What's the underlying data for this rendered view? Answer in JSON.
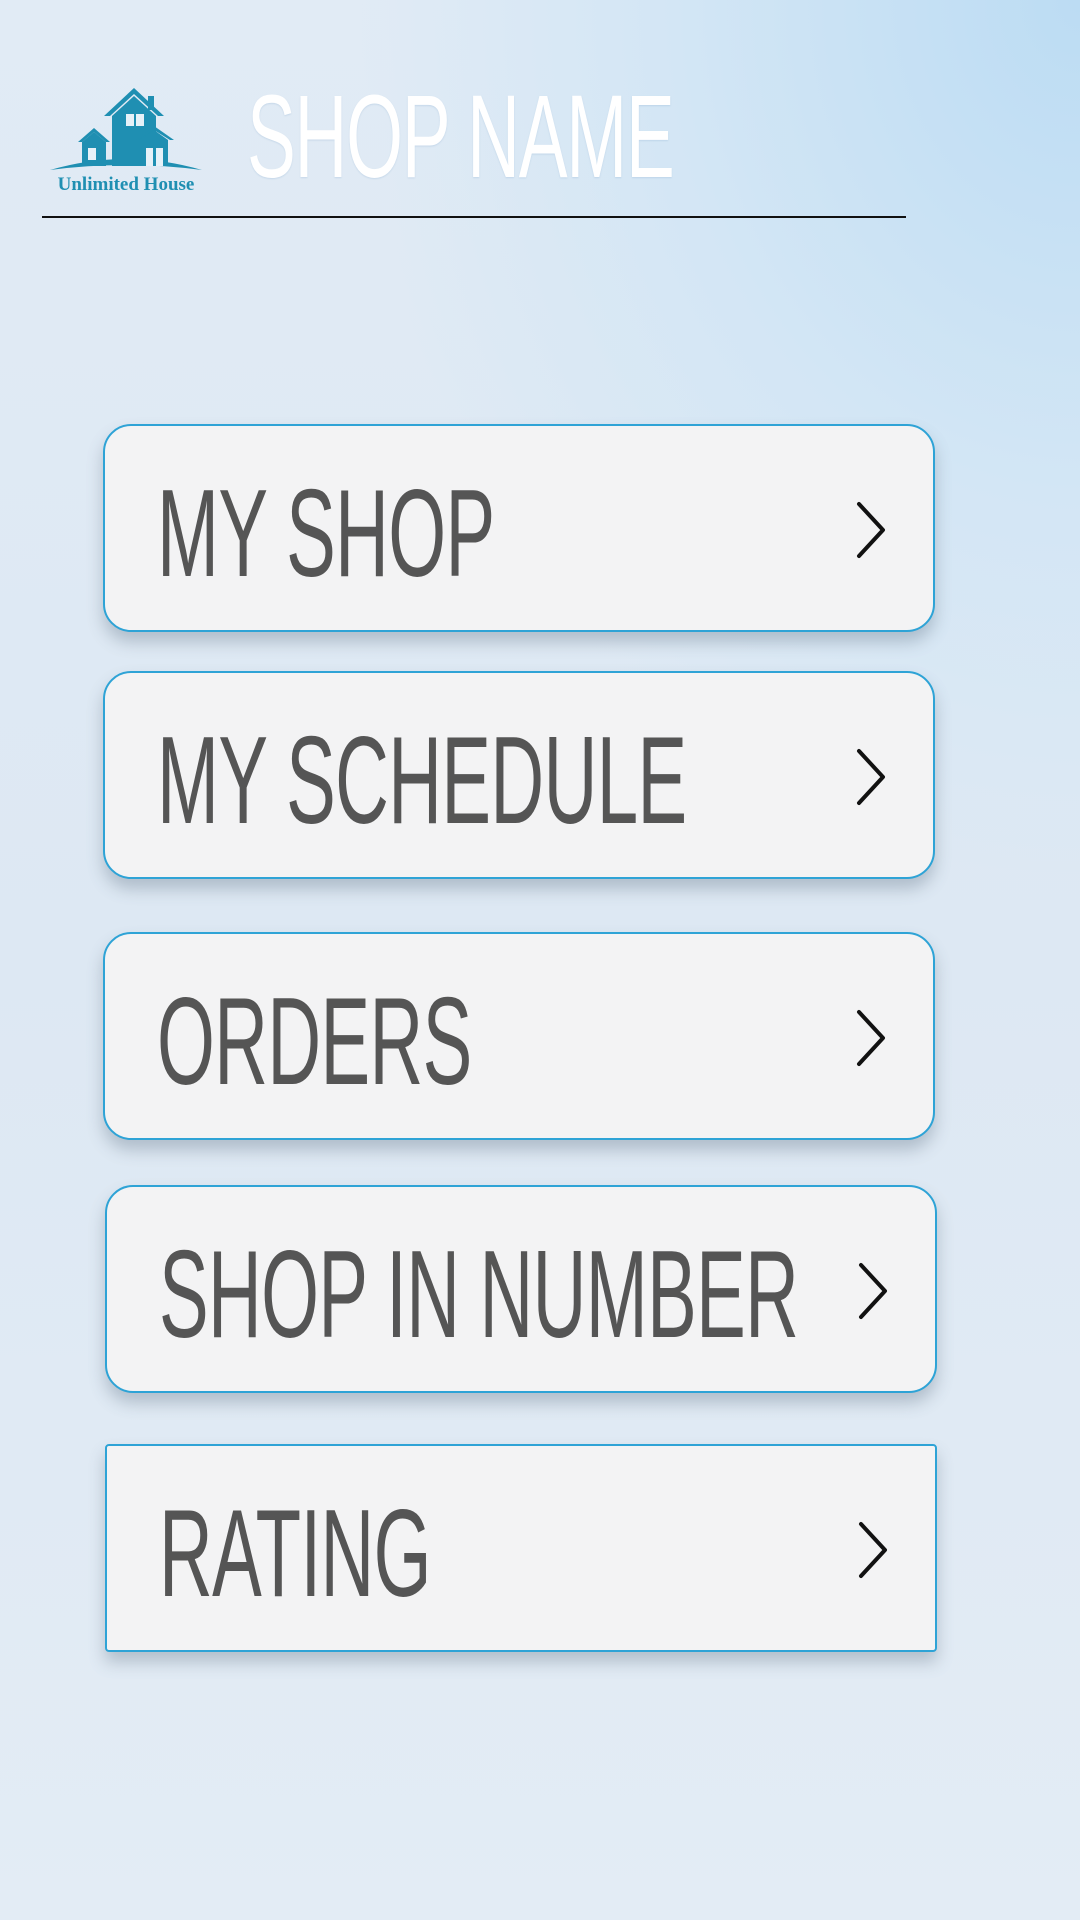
{
  "header": {
    "logo_caption": "Unlimited House",
    "shop_name": "SHOP NAME"
  },
  "colors": {
    "accent": "#2ea3d6",
    "logo": "#1f8fb2",
    "label": "#555555",
    "button_bg": "#f3f3f4"
  },
  "menu": {
    "items": [
      {
        "label": "MY SHOP",
        "icon": "chevron-right-icon"
      },
      {
        "label": "MY SCHEDULE",
        "icon": "chevron-right-icon"
      },
      {
        "label": "ORDERS",
        "icon": "chevron-right-icon"
      },
      {
        "label": "SHOP IN NUMBER",
        "icon": "chevron-right-icon"
      },
      {
        "label": "RATING",
        "icon": "chevron-right-icon"
      }
    ]
  }
}
